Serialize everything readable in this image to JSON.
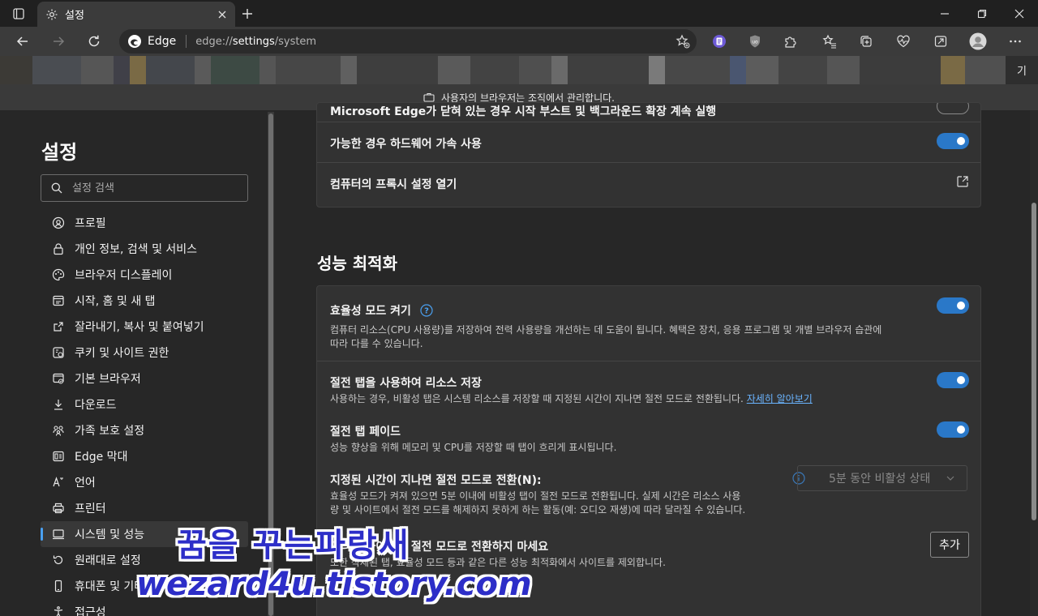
{
  "browser": {
    "tab_title": "설정",
    "address_brand": "Edge",
    "url_prefix": "edge://",
    "url_host": "settings",
    "url_path": "/system",
    "favbar_tail": "기",
    "managed_banner": "사용자의 브라우저는 조직에서 관리합니다."
  },
  "sidebar": {
    "title": "설정",
    "search_placeholder": "설정 검색",
    "items": [
      {
        "label": "프로필",
        "icon": "profile-icon"
      },
      {
        "label": "개인 정보, 검색 및 서비스",
        "icon": "lock-icon"
      },
      {
        "label": "브라우저 디스플레이",
        "icon": "palette-icon"
      },
      {
        "label": "시작, 홈 및 새 탭",
        "icon": "home-tab-icon"
      },
      {
        "label": "잘라내기, 복사 및 붙여넣기",
        "icon": "share-icon"
      },
      {
        "label": "쿠키 및 사이트 권한",
        "icon": "cookie-icon"
      },
      {
        "label": "기본 브라우저",
        "icon": "default-browser-icon"
      },
      {
        "label": "다운로드",
        "icon": "download-icon"
      },
      {
        "label": "가족 보호 설정",
        "icon": "family-icon"
      },
      {
        "label": "Edge 막대",
        "icon": "edge-bar-icon"
      },
      {
        "label": "언어",
        "icon": "language-icon"
      },
      {
        "label": "프린터",
        "icon": "printer-icon"
      },
      {
        "label": "시스템 및 성능",
        "icon": "system-icon"
      },
      {
        "label": "원래대로 설정",
        "icon": "reset-icon"
      },
      {
        "label": "휴대폰 및 기타 장치",
        "icon": "phone-icon"
      },
      {
        "label": "접근성",
        "icon": "accessibility-icon"
      }
    ],
    "active_index": 12
  },
  "system_card": {
    "partial_row": "Microsoft Edge가 닫혀 있는 경우 시작 부스트 및 백그라운드 확장 계속 실행",
    "hw_accel": "가능한 경우 하드웨어 가속 사용",
    "proxy": "컴퓨터의 프록시 설정 열기"
  },
  "performance": {
    "heading": "성능 최적화",
    "efficiency_title": "효율성 모드 켜기",
    "efficiency_desc1": "컴퓨터 리소스(CPU 사용량)를 저장하여 전력 사용량을 개선하는 데 도움이 됩니다. 혜택은 장치, 응용 프로그램 및 개별 브라우저 습관에",
    "efficiency_desc2": "따라 다를 수 있습니다.",
    "sleeping_title": "절전 탭을 사용하여 리소스 저장",
    "sleeping_desc": "사용하는 경우, 비활성 탭은 시스템 리소스를 저장할 때 지정된 시간이 지나면 절전 모드로 전환됩니다.",
    "sleeping_link": "자세히 알아보기",
    "fade_title": "절전 탭 페이드",
    "fade_desc": "성능 향상을 위해 메모리 및 CPU를 저장할 때 탭이 흐리게 표시됩니다.",
    "timeout_title": "지정된 시간이 지나면 절전 모드로 전환(N):",
    "timeout_desc1": "효율성 모드가 켜져 있으면 5분 이내에 비활성 탭이 절전 모드로 전환됩니다. 실제 시간은 리소스 사용",
    "timeout_desc2": "량 및 사이트에서 절전 모드를 해제하지 못하게 하는 활동(예: 오디오 재생)에 따라 달라질 수 있습니다.",
    "timeout_value": "5분 동안 비활성 상태",
    "never_title": "이러한 사이트를 절전 모드로 전환하지 마세요",
    "never_desc": "또한 삭제된 탭, 효율성 모드 등과 같은 다른 성능 최적화에서 사이트를 제외합니다.",
    "add_button": "추가"
  },
  "watermark": {
    "line1": "꿈을 꾸는파랑새",
    "line2": "wezard4u.tistory.com"
  },
  "colors": {
    "accent": "#2a78c8",
    "link": "#6ab4ff",
    "page_bg": "#272727",
    "card_bg": "#323232"
  }
}
